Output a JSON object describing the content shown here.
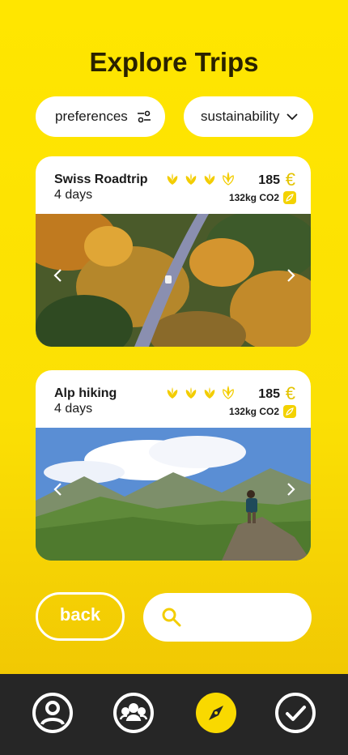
{
  "page": {
    "title": "Explore Trips"
  },
  "filters": {
    "preferences_label": "preferences",
    "sustainability_label": "sustainability"
  },
  "trips": [
    {
      "name": "Swiss Roadtrip",
      "duration": "4 days",
      "eco_rating": 3,
      "eco_rating_max": 4,
      "price": "185",
      "currency": "€",
      "co2": "132kg CO2",
      "photo": "autumn-forest-road"
    },
    {
      "name": "Alp hiking",
      "duration": "4 days",
      "eco_rating": 3,
      "eco_rating_max": 4,
      "price": "185",
      "currency": "€",
      "co2": "132kg CO2",
      "photo": "mountain-hiker"
    }
  ],
  "actions": {
    "back_label": "back",
    "search_placeholder": ""
  },
  "bottom_nav": [
    {
      "icon": "profile-icon",
      "active": false
    },
    {
      "icon": "group-icon",
      "active": false
    },
    {
      "icon": "compass-icon",
      "active": true
    },
    {
      "icon": "check-icon",
      "active": false
    }
  ],
  "colors": {
    "accent": "#fbe004",
    "nav_background": "#262626",
    "leaf": "#f3cd00"
  }
}
